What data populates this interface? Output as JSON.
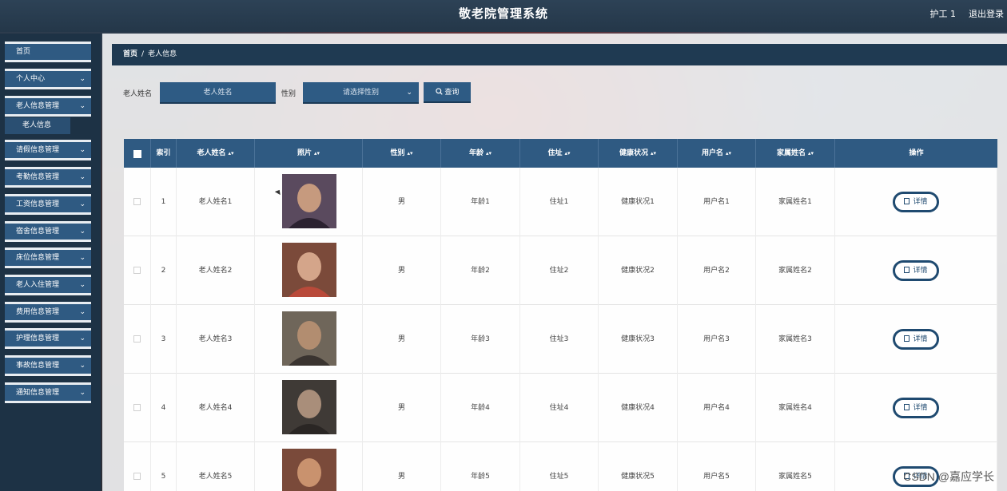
{
  "header": {
    "title": "敬老院管理系统",
    "user": "护工 1",
    "logout": "退出登录"
  },
  "sidebar": {
    "items": [
      {
        "label": "首页",
        "has_chevron": false
      },
      {
        "label": "个人中心",
        "has_chevron": true
      },
      {
        "label": "老人信息管理",
        "has_chevron": true
      },
      {
        "label": "请假信息管理",
        "has_chevron": true
      },
      {
        "label": "考勤信息管理",
        "has_chevron": true
      },
      {
        "label": "工资信息管理",
        "has_chevron": true
      },
      {
        "label": "宿舍信息管理",
        "has_chevron": true
      },
      {
        "label": "床位信息管理",
        "has_chevron": true
      },
      {
        "label": "老人入住管理",
        "has_chevron": true
      },
      {
        "label": "费用信息管理",
        "has_chevron": true
      },
      {
        "label": "护理信息管理",
        "has_chevron": true
      },
      {
        "label": "事故信息管理",
        "has_chevron": true
      },
      {
        "label": "通知信息管理",
        "has_chevron": true
      }
    ],
    "submenu": {
      "label": "老人信息"
    }
  },
  "breadcrumb": {
    "home": "首页",
    "separator": "/",
    "current": "老人信息"
  },
  "search": {
    "name_label": "老人姓名",
    "name_placeholder": "老人姓名",
    "gender_label": "性别",
    "gender_placeholder": "请选择性别",
    "query_button": "查询"
  },
  "table": {
    "columns": [
      "索引",
      "老人姓名",
      "照片",
      "性别",
      "年龄",
      "住址",
      "健康状况",
      "用户名",
      "家属姓名",
      "操作"
    ],
    "detail_label": "详情",
    "rows": [
      {
        "index": "1",
        "name": "老人姓名1",
        "gender": "男",
        "age": "年龄1",
        "address": "住址1",
        "health": "健康状况1",
        "username": "用户名1",
        "family": "家属姓名1"
      },
      {
        "index": "2",
        "name": "老人姓名2",
        "gender": "男",
        "age": "年龄2",
        "address": "住址2",
        "health": "健康状况2",
        "username": "用户名2",
        "family": "家属姓名2"
      },
      {
        "index": "3",
        "name": "老人姓名3",
        "gender": "男",
        "age": "年龄3",
        "address": "住址3",
        "health": "健康状况3",
        "username": "用户名3",
        "family": "家属姓名3"
      },
      {
        "index": "4",
        "name": "老人姓名4",
        "gender": "男",
        "age": "年龄4",
        "address": "住址4",
        "health": "健康状况4",
        "username": "用户名4",
        "family": "家属姓名4"
      },
      {
        "index": "5",
        "name": "老人姓名5",
        "gender": "男",
        "age": "年龄5",
        "address": "住址5",
        "health": "健康状况5",
        "username": "用户名5",
        "family": "家属姓名5"
      }
    ]
  },
  "watermark": "CSDN @嘉应学长",
  "colors": {
    "accent": "#2f5a82",
    "header_bg": "#243749",
    "breadcrumb_bg": "#1f3a52",
    "button_border": "#1f4a70"
  }
}
